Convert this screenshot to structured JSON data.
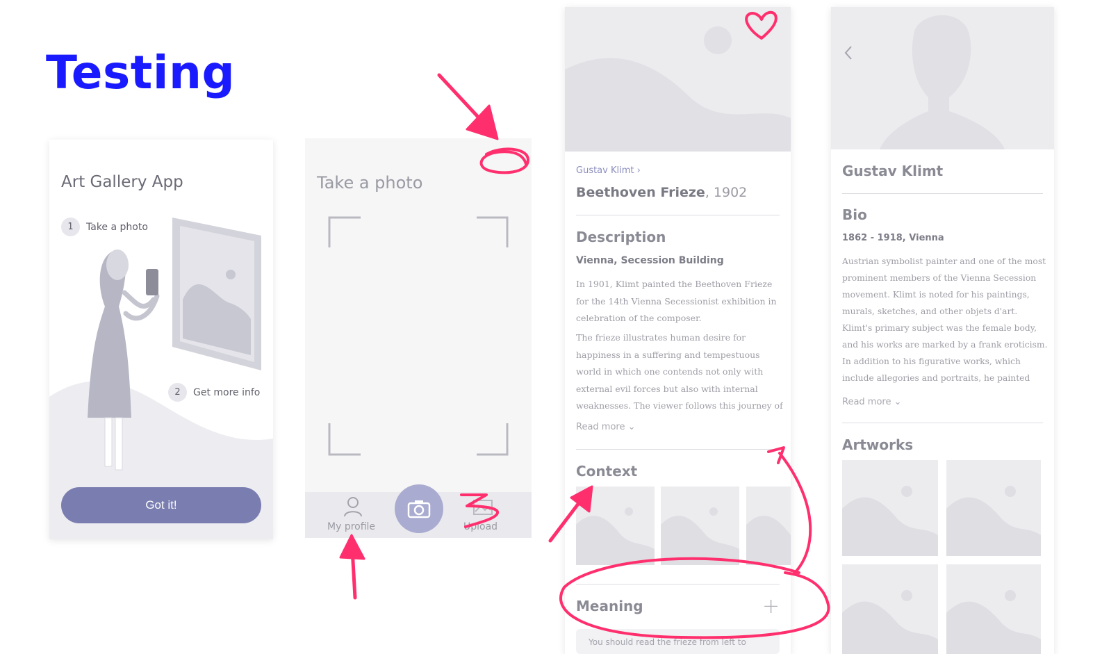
{
  "page_title": "Testing",
  "card1": {
    "title": "Art Gallery App",
    "step1": {
      "num": "1",
      "label": "Take a photo"
    },
    "step2": {
      "num": "2",
      "label": "Get more info"
    },
    "button": "Got it!"
  },
  "card2": {
    "title": "Take a photo",
    "profile_label": "My profile",
    "upload_label": "Upload"
  },
  "card3": {
    "breadcrumb": "Gustav Klimt ›",
    "artwork_name": "Beethoven Frieze",
    "artwork_year": ", 1902",
    "description_heading": "Description",
    "location": "Vienna, Secession Building",
    "para1": "In 1901, Klimt painted the Beethoven Frieze for the 14th Vienna Secessionist exhibition in celebration of the composer.",
    "para2": "The frieze illustrates human desire for happiness in a suffering and tempestuous world in which one contends not only with external evil forces but also with internal weaknesses. The viewer follows this journey of discovery in...",
    "read_more": "Read more ⌄",
    "context_heading": "Context",
    "meaning_heading": "Meaning",
    "meaning_plus": "+",
    "meaning_snippet": "You should read the frieze from left to"
  },
  "card4": {
    "artist_name": "Gustav Klimt",
    "bio_heading": "Bio",
    "bio_dates": "1862 - 1918, Vienna",
    "bio_text": "Austrian symbolist painter and one of the most prominent members of the Vienna Secession movement. Klimt is noted for his paintings, murals, sketches, and other objets d'art. Klimt's primary subject was the female body, and his works are marked by a frank eroticism. In addition to his figurative works, which include allegories and portraits, he painted landscapes...",
    "read_more": "Read more ⌄",
    "artworks_heading": "Artworks"
  },
  "colors": {
    "title_blue": "#1a1aff",
    "annotation_pink": "#ff2f6e",
    "accent_purple": "#7a7db0",
    "placeholder_gray": "#ececef"
  },
  "icons": [
    "person-icon",
    "camera-icon",
    "upload-icon",
    "heart-icon",
    "back-chevron-icon",
    "plus-icon",
    "image-placeholder-icon"
  ]
}
